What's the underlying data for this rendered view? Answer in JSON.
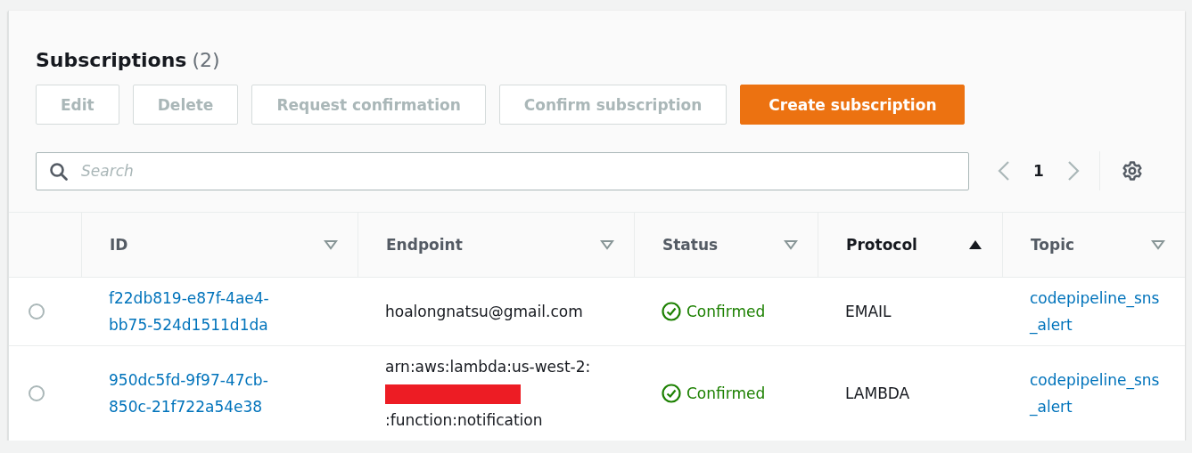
{
  "panel": {
    "title": "Subscriptions",
    "count": "(2)"
  },
  "buttons": [
    {
      "label": "Edit",
      "kind": "normal",
      "disabled": true
    },
    {
      "label": "Delete",
      "kind": "normal",
      "disabled": true
    },
    {
      "label": "Request confirmation",
      "kind": "normal",
      "disabled": true
    },
    {
      "label": "Confirm subscription",
      "kind": "normal",
      "disabled": true
    },
    {
      "label": "Create subscription",
      "kind": "primary",
      "disabled": false
    }
  ],
  "search": {
    "placeholder": "Search"
  },
  "pagination": {
    "page": "1"
  },
  "table": {
    "columns": [
      {
        "label": "ID",
        "sorted": false
      },
      {
        "label": "Endpoint",
        "sorted": false
      },
      {
        "label": "Status",
        "sorted": false
      },
      {
        "label": "Protocol",
        "sorted": true
      },
      {
        "label": "Topic",
        "sorted": false
      }
    ],
    "rows": [
      {
        "selected": false,
        "id": "f22db819-e87f-4ae4-bb75-524d1511d1da",
        "endpoint": {
          "before": "hoalongnatsu@gmail.com"
        },
        "status": {
          "kind": "confirmed",
          "label": "Confirmed"
        },
        "protocol": "EMAIL",
        "topic": "codepipeline_sns_alert"
      },
      {
        "selected": false,
        "id": "950dc5fd-9f97-47cb-850c-21f722a54e38",
        "endpoint": {
          "before": "arn:aws:lambda:us-west-2:",
          "redacted": true,
          "after": ":function:notification"
        },
        "status": {
          "kind": "confirmed",
          "label": "Confirmed"
        },
        "protocol": "LAMBDA",
        "topic": "codepipeline_sns_alert"
      }
    ]
  }
}
